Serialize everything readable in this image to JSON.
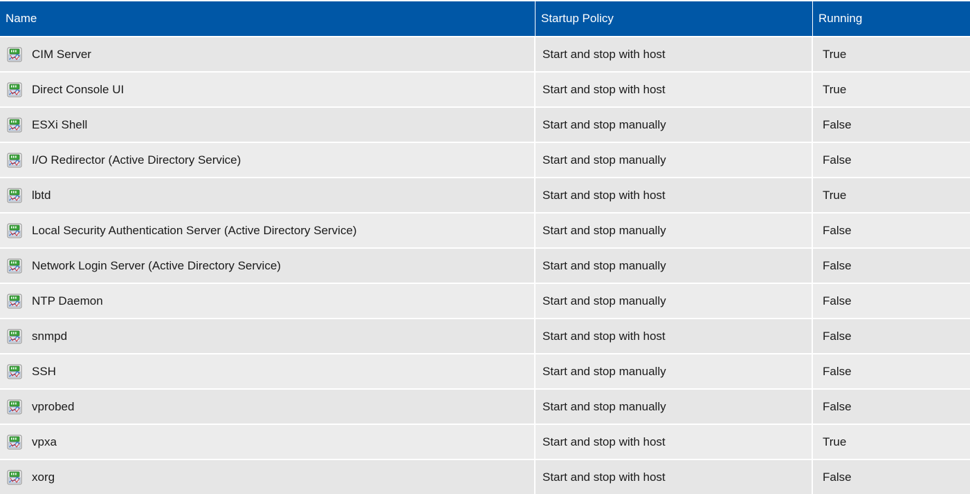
{
  "table": {
    "columns": {
      "name": "Name",
      "policy": "Startup Policy",
      "running": "Running"
    },
    "rows": [
      {
        "name": "CIM Server",
        "policy": "Start and stop with host",
        "running": "True",
        "icon": "service-icon"
      },
      {
        "name": "Direct Console UI",
        "policy": "Start and stop with host",
        "running": "True",
        "icon": "service-icon"
      },
      {
        "name": "ESXi Shell",
        "policy": "Start and stop manually",
        "running": "False",
        "icon": "service-icon"
      },
      {
        "name": "I/O Redirector (Active Directory Service)",
        "policy": "Start and stop manually",
        "running": "False",
        "icon": "service-icon"
      },
      {
        "name": "lbtd",
        "policy": "Start and stop with host",
        "running": "True",
        "icon": "service-icon"
      },
      {
        "name": "Local Security Authentication Server (Active Directory Service)",
        "policy": "Start and stop manually",
        "running": "False",
        "icon": "service-icon"
      },
      {
        "name": "Network Login Server (Active Directory Service)",
        "policy": "Start and stop manually",
        "running": "False",
        "icon": "service-icon"
      },
      {
        "name": "NTP Daemon",
        "policy": "Start and stop manually",
        "running": "False",
        "icon": "service-icon"
      },
      {
        "name": "snmpd",
        "policy": "Start and stop with host",
        "running": "False",
        "icon": "service-icon"
      },
      {
        "name": "SSH",
        "policy": "Start and stop manually",
        "running": "False",
        "icon": "service-icon"
      },
      {
        "name": "vprobed",
        "policy": "Start and stop manually",
        "running": "False",
        "icon": "service-icon"
      },
      {
        "name": "vpxa",
        "policy": "Start and stop with host",
        "running": "True",
        "icon": "service-icon"
      },
      {
        "name": "xorg",
        "policy": "Start and stop with host",
        "running": "False",
        "icon": "service-icon"
      }
    ]
  },
  "colors": {
    "header_bg": "#0057a6",
    "header_text": "#ffffff",
    "row_bg": "#e6e6e6"
  }
}
